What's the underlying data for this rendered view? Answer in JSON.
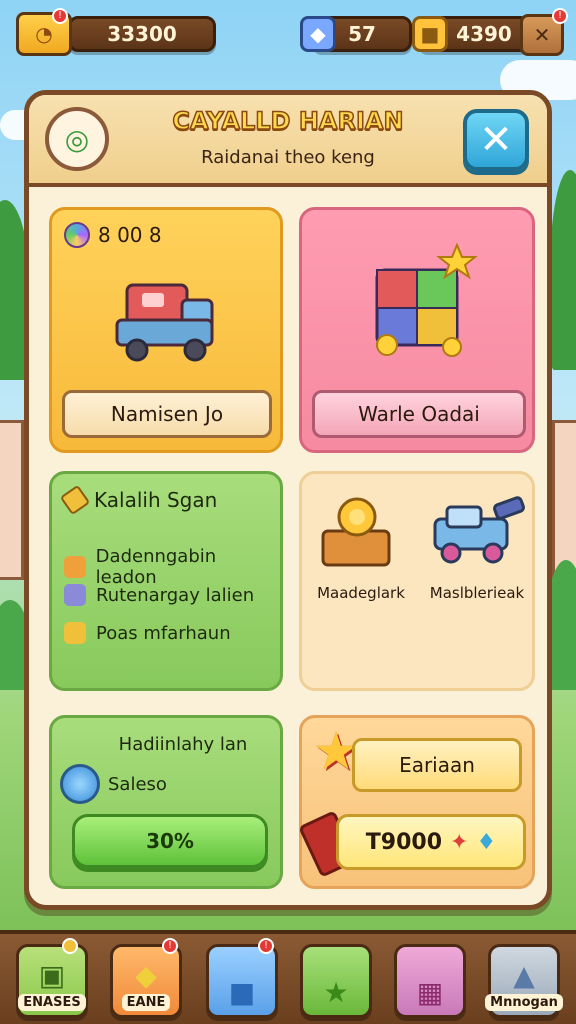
{
  "top_bar": {
    "coins": "33300",
    "gems": "57",
    "cubes": "4390"
  },
  "panel": {
    "title": "CAYALLD HARIAN",
    "subtitle": "Raidanai theo keng"
  },
  "cards": {
    "truck_offer": {
      "cost": "8 00 8",
      "label": "Namisen Jo"
    },
    "box_offer": {
      "label": "Warle Oadai"
    },
    "quest": {
      "title": "Kalalih Sgan",
      "items": [
        "Dadenngabin leadon",
        "Rutenargay lalien",
        "Poas mfarhaun"
      ]
    },
    "items": {
      "left_label": "Maadeglark",
      "right_label": "Maslblerieak"
    },
    "progress": {
      "title": "Hadiinlahy lan",
      "subtitle": "Saleso",
      "value_label": "30%",
      "value": 0.3
    },
    "reward": {
      "label": "Eariaan",
      "price": "T9000"
    }
  },
  "bottom_nav": [
    {
      "label": "ENASES",
      "icon": "book-icon"
    },
    {
      "label": "EANE",
      "icon": "box-icon"
    },
    {
      "label": "",
      "icon": "cube-icon"
    },
    {
      "label": "",
      "icon": "star-icon"
    },
    {
      "label": "",
      "icon": "gift-icon"
    },
    {
      "label": "Mnnogan",
      "icon": "crystal-icon"
    }
  ]
}
